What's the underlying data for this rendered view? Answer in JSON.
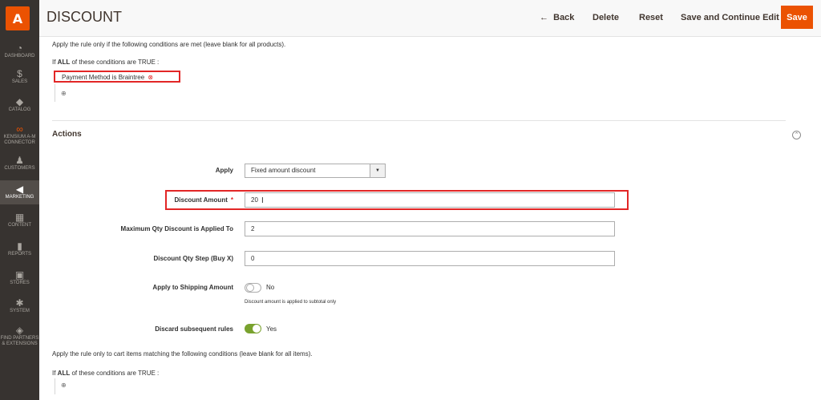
{
  "sidebar": {
    "logo": "A",
    "items": [
      {
        "label": "DASHBOARD",
        "icon": "dashboard-icon",
        "glyph": "◔"
      },
      {
        "label": "SALES",
        "icon": "dollar-icon",
        "glyph": "$"
      },
      {
        "label": "CATALOG",
        "icon": "cube-icon",
        "glyph": "◆"
      },
      {
        "label": "KENSIUM A-M CONNECTOR",
        "icon": "connector-icon",
        "glyph": "∞"
      },
      {
        "label": "CUSTOMERS",
        "icon": "person-icon",
        "glyph": "♟"
      },
      {
        "label": "MARKETING",
        "icon": "megaphone-icon",
        "glyph": "◀"
      },
      {
        "label": "CONTENT",
        "icon": "layout-icon",
        "glyph": "▦"
      },
      {
        "label": "REPORTS",
        "icon": "bar-chart-icon",
        "glyph": "▮"
      },
      {
        "label": "STORES",
        "icon": "store-icon",
        "glyph": "▣"
      },
      {
        "label": "SYSTEM",
        "icon": "gear-icon",
        "glyph": "✱"
      },
      {
        "label": "FIND PARTNERS & EXTENSIONS",
        "icon": "box-icon",
        "glyph": "◈"
      }
    ]
  },
  "header": {
    "title": "DISCOUNT",
    "back_label": "Back",
    "back_arrow": "←",
    "delete_label": "Delete",
    "reset_label": "Reset",
    "save_continue_label": "Save and Continue Edit",
    "save_label": "Save"
  },
  "conditions": {
    "intro": "Apply the rule only if the following conditions are met (leave blank for all products).",
    "if_all_prefix": "If ",
    "if_all_keyword": "ALL",
    "if_all_suffix": "  of these conditions are TRUE :",
    "rule_text": "Payment Method  is  Braintree",
    "remove_glyph": "⊗",
    "add_glyph": "⊕"
  },
  "actions": {
    "title": "Actions",
    "collapse_glyph": "⌃",
    "apply_label": "Apply",
    "apply_value": "Fixed amount discount",
    "apply_arrow": "▼",
    "discount_amount_label": "Discount Amount",
    "required_marker": "*",
    "discount_amount_value": "20",
    "max_qty_label": "Maximum Qty Discount is Applied To",
    "max_qty_value": "2",
    "qty_step_label": "Discount Qty Step (Buy X)",
    "qty_step_value": "0",
    "shipping_label": "Apply to Shipping Amount",
    "shipping_state": "No",
    "shipping_note": "Discount amount is applied to subtotal only",
    "discard_label": "Discard subsequent rules",
    "discard_state": "Yes"
  },
  "cart_conditions": {
    "intro": "Apply the rule only to cart items matching the following conditions (leave blank for all items).",
    "if_all_prefix": "If ",
    "if_all_keyword": "ALL",
    "if_all_suffix": "  of these conditions are TRUE :",
    "add_glyph": "⊕"
  }
}
